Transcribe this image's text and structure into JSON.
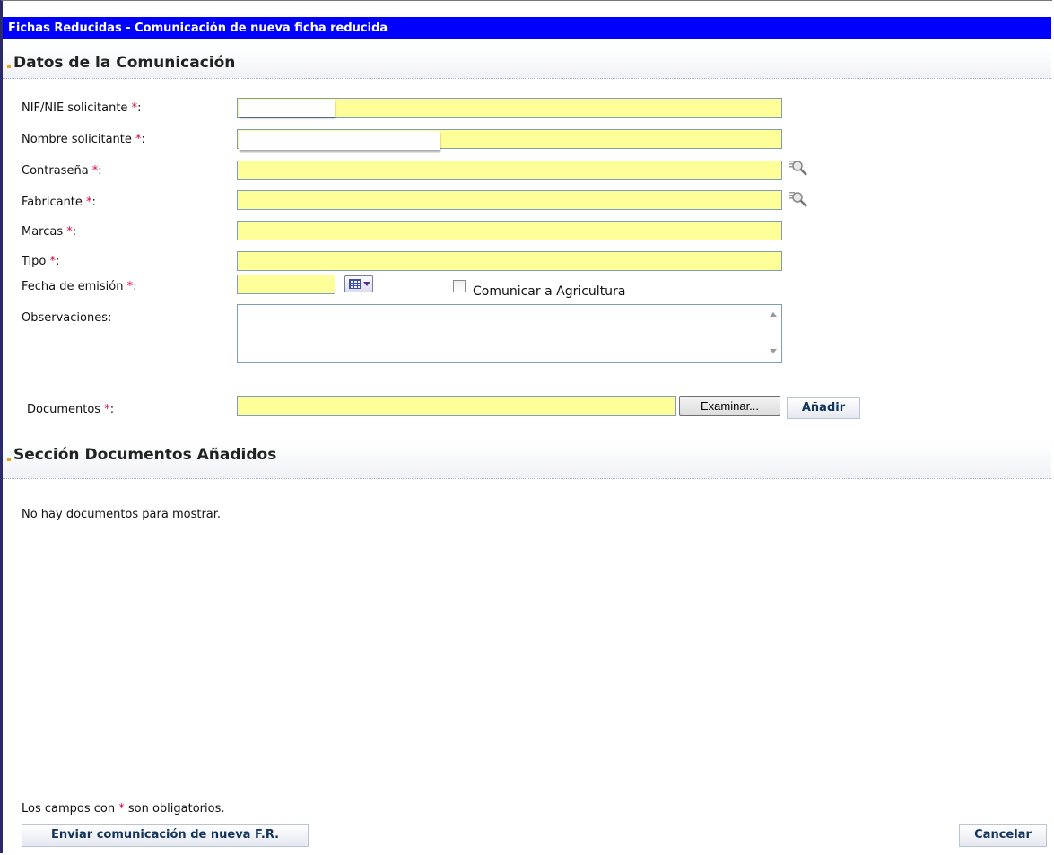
{
  "window": {
    "title": "Fichas Reducidas - Comunicación de nueva ficha reducida"
  },
  "sections": {
    "datos": "Datos de la Comunicación",
    "documentos": "Sección Documentos Añadidos"
  },
  "required_marker": "*",
  "form": {
    "nif_label": "NIF/NIE solicitante ",
    "nombre_label": "Nombre solicitante ",
    "contrasena_label": "Contraseña ",
    "fabricante_label": "Fabricante ",
    "marcas_label": "Marcas ",
    "tipo_label": "Tipo ",
    "fecha_label": "Fecha de emisión ",
    "observaciones_label": "Observaciones:",
    "documentos_label": "Documentos ",
    "label_colon": ":",
    "comunicar_agricultura_label": "Comunicar a Agricultura",
    "comunicar_agricultura_checked": false
  },
  "buttons": {
    "examinar": "Examinar...",
    "anadir": "Añadir",
    "enviar": "Enviar comunicación de nueva F.R.",
    "cancelar": "Cancelar"
  },
  "documents_empty_text": "No hay documentos para mostrar.",
  "footnote": {
    "before": "Los campos con ",
    "after": " son obligatorios."
  },
  "icons": {
    "lookup": "magnifier-icon",
    "calendar": "calendar-icon"
  },
  "colors": {
    "title_bar": "#0000ff",
    "field_bg": "#ffff99",
    "required": "#e0003a",
    "section_marker": "#f0a020"
  }
}
